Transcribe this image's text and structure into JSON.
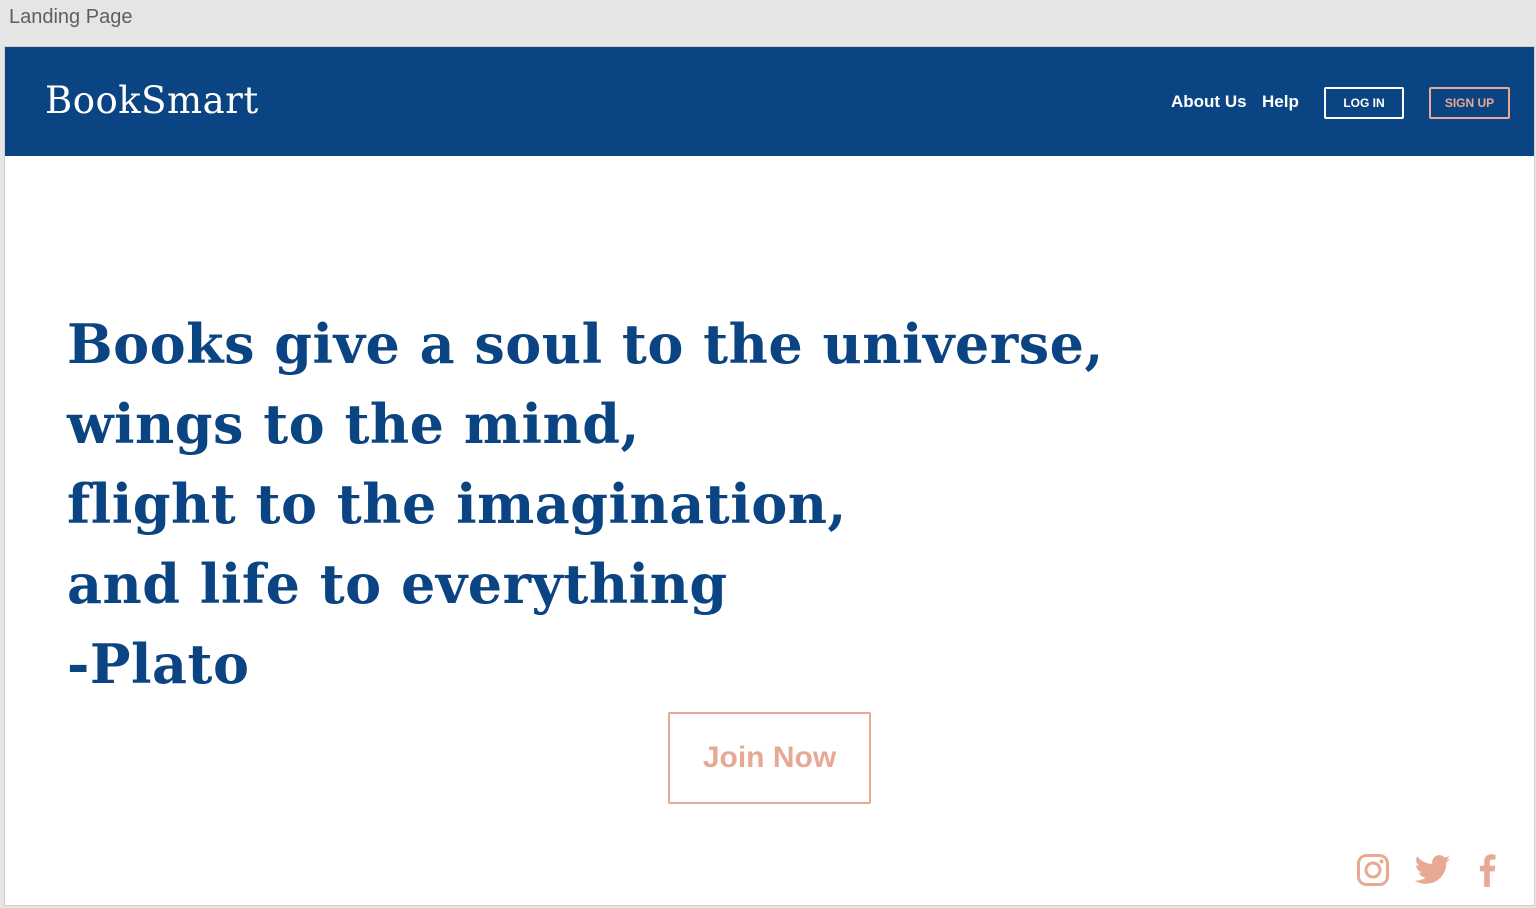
{
  "window": {
    "title": "Landing Page"
  },
  "header": {
    "logo": "BookSmart",
    "nav": {
      "about_label": "About Us",
      "help_label": "Help"
    },
    "login_label": "LOG IN",
    "signup_label": "SIGN UP"
  },
  "hero": {
    "quote_lines": [
      "Books give a soul to the universe,",
      "wings to the mind,",
      "flight to the imagination,",
      "and life to everything",
      "-Plato"
    ],
    "cta_label": "Join Now"
  },
  "footer": {
    "social_icons": [
      "instagram-icon",
      "twitter-icon",
      "facebook-icon"
    ]
  },
  "colors": {
    "primary_navy": "#0b4482",
    "accent_peach": "#e8a994",
    "background": "#ffffff"
  }
}
